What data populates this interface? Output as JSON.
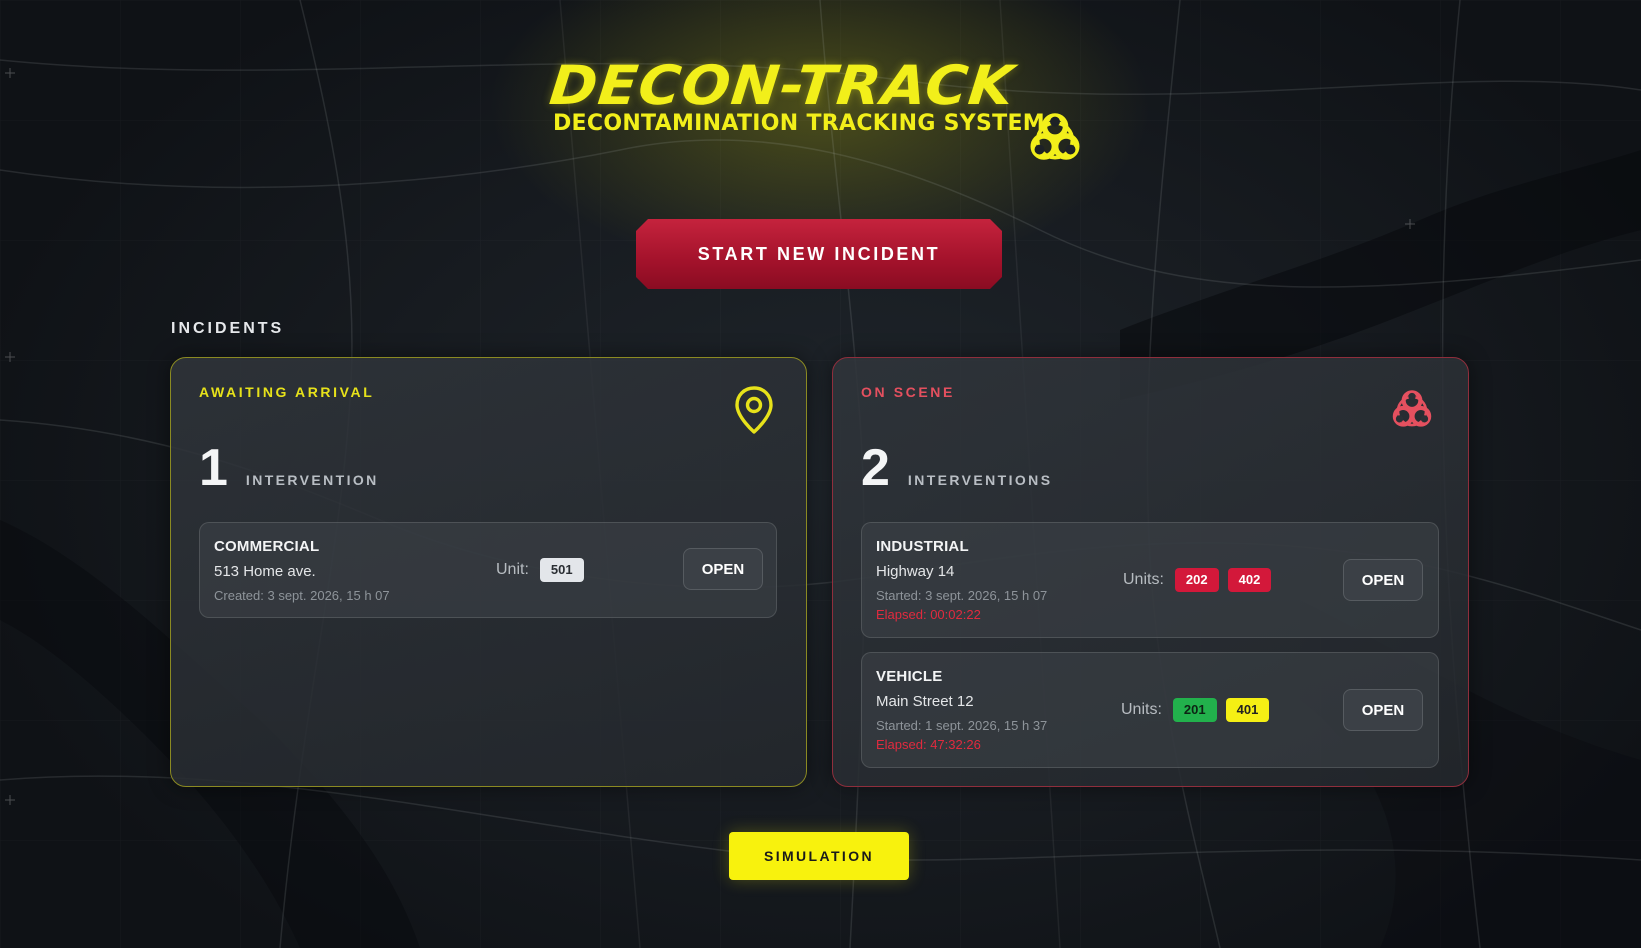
{
  "logo": {
    "title": "DECON-TRACK",
    "subtitle": "DECONTAMINATION TRACKING SYSTEM"
  },
  "actions": {
    "start_incident": "START NEW INCIDENT",
    "simulation": "SIMULATION"
  },
  "incidents": {
    "section_title": "INCIDENTS",
    "awaiting": {
      "status": "AWAITING ARRIVAL",
      "icon": "map-pin-icon",
      "count": "1",
      "count_label": "INTERVENTION",
      "cards": [
        {
          "type": "COMMERCIAL",
          "address": "513 Home ave.",
          "created": "Created: 3 sept. 2026, 15 h 07",
          "units_label": "Unit:",
          "units": [
            "501"
          ],
          "open_label": "OPEN"
        }
      ]
    },
    "on_scene": {
      "status": "ON SCENE",
      "icon": "biohazard-icon",
      "count": "2",
      "count_label": "INTERVENTIONS",
      "cards": [
        {
          "type": "INDUSTRIAL",
          "address": "Highway 14",
          "started": "Started: 3 sept. 2026, 15 h 07",
          "elapsed": "Elapsed: 00:02:22",
          "units_label": "Units:",
          "units": [
            "202",
            "402"
          ],
          "open_label": "OPEN"
        },
        {
          "type": "VEHICLE",
          "address": "Main Street 12",
          "started": "Started: 1 sept. 2026, 15 h 37",
          "elapsed": "Elapsed: 47:32:26",
          "units_label": "Units:",
          "units": [
            "201",
            "401"
          ],
          "open_label": "OPEN"
        }
      ]
    }
  },
  "colors": {
    "brand_yellow": "#f2ef1a",
    "alert_red": "#d3183a",
    "unit_green": "#22b14c",
    "unit_yellow": "#f5ef14",
    "panel_awaiting_border": "#8b8a22",
    "panel_onscene_border": "#8f2e3c"
  }
}
